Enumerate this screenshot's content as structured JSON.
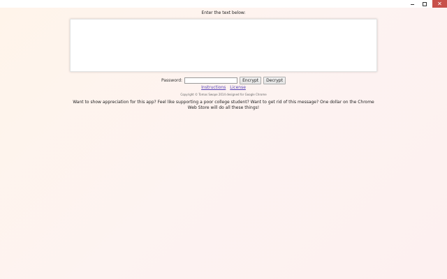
{
  "window": {
    "minimize_icon": "minimize-icon",
    "maximize_icon": "maximize-icon",
    "close_icon": "close-icon",
    "close_glyph": "✕",
    "close_color": "#c7504a"
  },
  "main": {
    "prompt": "Enter the text below:",
    "textarea_value": "",
    "password_label": "Password:",
    "password_value": "",
    "encrypt_label": "Encrypt",
    "decrypt_label": "Decrypt",
    "instructions_link": "Instructions",
    "license_link": "License",
    "copyright": "Copyright © Tomas Swope 2014 designed for Google Chrome",
    "appeal": "Want to show appreciation for this app? Feel like supporting a poor college student? Want to get rid of this message? One dollar on the Chrome Web Store will do all these things!"
  },
  "colors": {
    "link": "#5540b8",
    "background_start": "#fff4ea",
    "background_end": "#fdf0f0"
  }
}
